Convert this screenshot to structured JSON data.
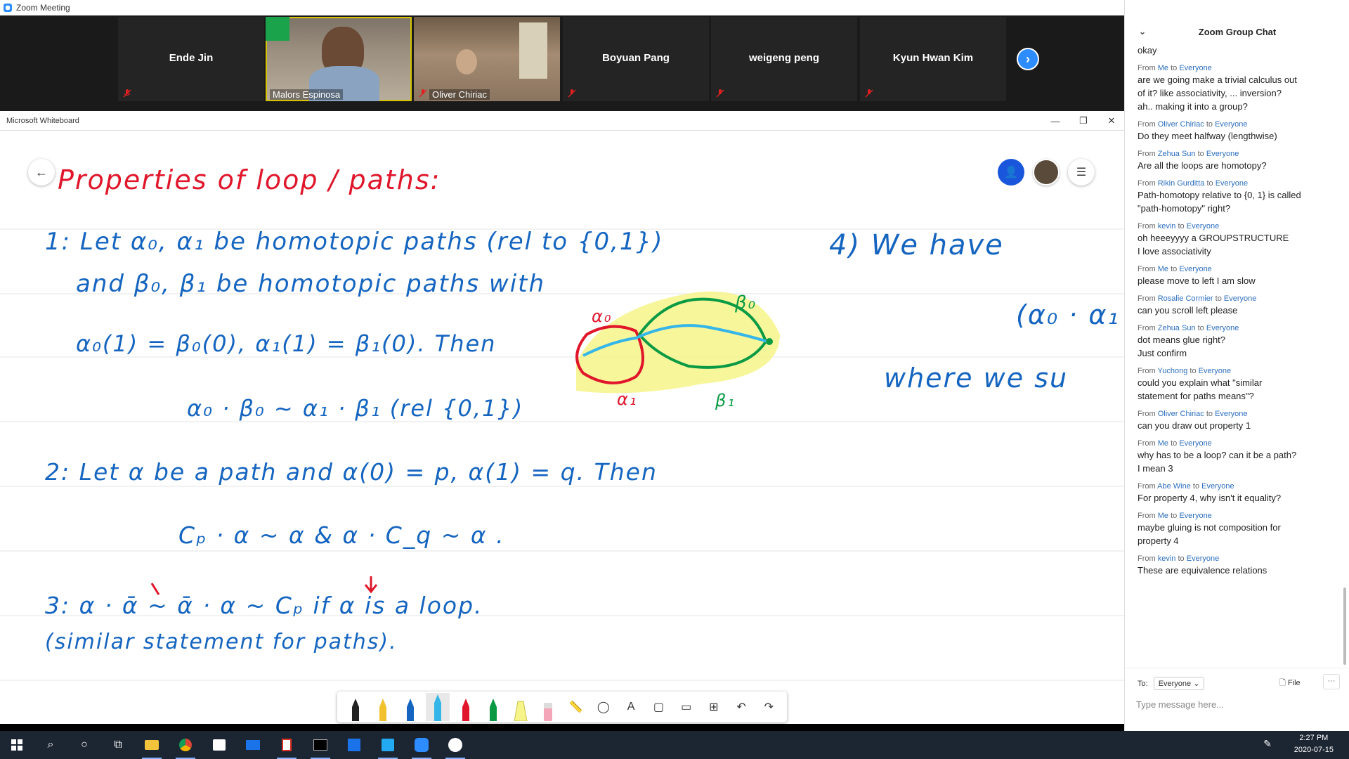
{
  "zoom": {
    "title": "Zoom Meeting",
    "participants": [
      {
        "name": "Ende Jin",
        "video": false
      },
      {
        "name": "Malors Espinosa",
        "video": true
      },
      {
        "name": "Oliver Chiriac",
        "video": true
      },
      {
        "name": "Boyuan Pang",
        "video": false
      },
      {
        "name": "weigeng peng",
        "video": false
      },
      {
        "name": "Kyun Hwan Kim",
        "video": false
      }
    ],
    "next_icon": "chevron-right-icon"
  },
  "whiteboard": {
    "title": "Microsoft Whiteboard",
    "heading": "Properties of loop / paths:",
    "lines": [
      "1: Let α₀, α₁ be homotopic paths (rel to {0,1})",
      "and β₀, β₁ be homotopic paths with",
      "α₀(1) = β₀(0),   α₁(1) = β₁(0). Then",
      "α₀ · β₀ ~ α₁ · β₁  (rel {0,1})",
      "2: Let α be a path and α(0) = p, α(1) = q. Then",
      "Cₚ · α ~ α   &   α · C_q ~ α .",
      "3:   α · ᾱ ~ ᾱ · α ~ Cₚ   if α is a loop.",
      "(similar statement for paths)."
    ],
    "right_lines": [
      "4) We  have",
      "(α₀ · α₁",
      "where  we  su"
    ],
    "sketch_labels": {
      "a0": "α₀",
      "a1": "α₁",
      "b0": "β₀",
      "b1": "β₁"
    },
    "colors": {
      "ink_blue": "#1565c0",
      "ink_red": "#e0162b",
      "ink_green": "#0a9a44",
      "highlight": "#f7f48a",
      "ink_cyan": "#35b6e9"
    },
    "tools": [
      "pen-black-icon",
      "pen-yellow-icon",
      "pen-blue-icon",
      "pen-cyan-icon",
      "pen-red-icon",
      "pen-green-icon",
      "highlighter-icon",
      "eraser-icon",
      "ruler-icon",
      "lasso-icon",
      "text-icon",
      "shape-icon",
      "image-icon",
      "insert-icon",
      "undo-icon",
      "redo-icon"
    ]
  },
  "chat": {
    "title": "Zoom Group Chat",
    "messages": [
      {
        "from": "",
        "to": "",
        "lines": [
          "okay"
        ]
      },
      {
        "from": "Me",
        "to": "Everyone",
        "lines": [
          "are we going make a trivial calculus out",
          "of it? like associativity, ... inversion?",
          "ah.. making it into a group?"
        ]
      },
      {
        "from": "Oliver Chiriac",
        "to": "Everyone",
        "lines": [
          "Do they meet halfway (lengthwise)"
        ]
      },
      {
        "from": "Zehua Sun",
        "to": "Everyone",
        "lines": [
          "Are all the loops are homotopy?"
        ]
      },
      {
        "from": "Rikin Gurditta",
        "to": "Everyone",
        "lines": [
          "Path-homotopy relative to {0, 1} is called",
          "\"path-homotopy\" right?"
        ]
      },
      {
        "from": "kevin",
        "to": "Everyone",
        "lines": [
          "oh heeeyyyy a GROUPSTRUCTURE",
          "I love associativity"
        ]
      },
      {
        "from": "Me",
        "to": "Everyone",
        "lines": [
          "please move to left I am slow"
        ]
      },
      {
        "from": "Rosalie Cormier",
        "to": "Everyone",
        "lines": [
          "can you scroll left please"
        ]
      },
      {
        "from": "Zehua Sun",
        "to": "Everyone",
        "lines": [
          "dot means glue right?",
          "Just confirm"
        ]
      },
      {
        "from": "Yuchong",
        "to": "Everyone",
        "lines": [
          "could you explain what \"similar",
          "statement for paths means\"?"
        ]
      },
      {
        "from": "Oliver Chiriac",
        "to": "Everyone",
        "lines": [
          "can you draw out property 1"
        ]
      },
      {
        "from": "Me",
        "to": "Everyone",
        "lines": [
          "why has to be a loop? can it be a path?",
          "I mean 3"
        ]
      },
      {
        "from": "Abe Wine",
        "to": "Everyone",
        "lines": [
          "For property 4, why isn't it equality?"
        ]
      },
      {
        "from": "Me",
        "to": "Everyone",
        "lines": [
          "maybe gluing is not composition for",
          "property 4"
        ]
      },
      {
        "from": "kevin",
        "to": "Everyone",
        "lines": [
          "These are equivalence relations"
        ]
      }
    ],
    "from_label": "From",
    "to_label": "to",
    "to_prefix": "To:",
    "to_value": "Everyone",
    "file_label": "File",
    "input_placeholder": "Type message here..."
  },
  "taskbar": {
    "time": "2:27 PM",
    "date": "2020-07-15"
  }
}
